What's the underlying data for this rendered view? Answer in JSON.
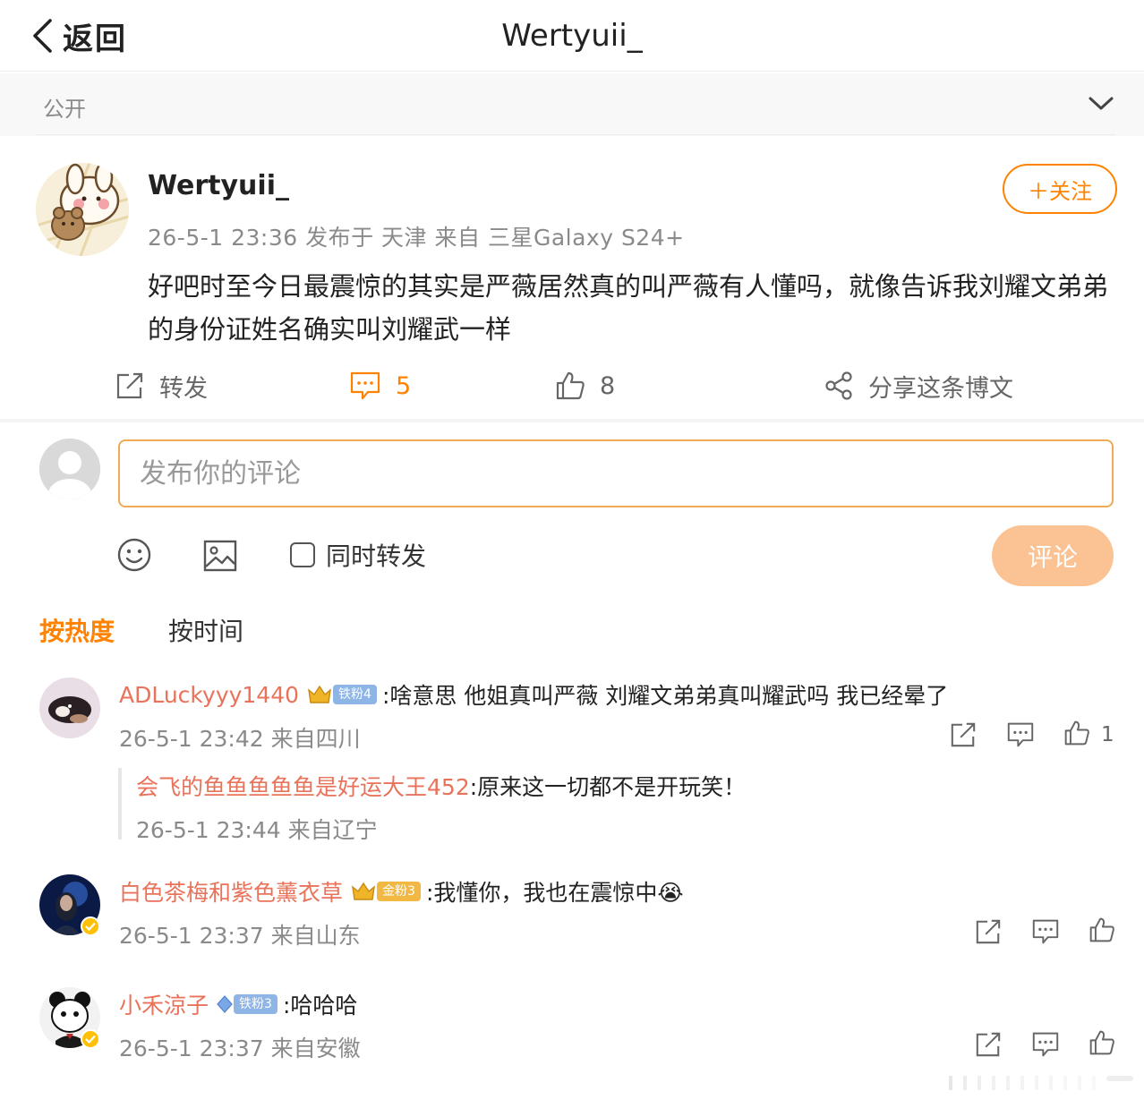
{
  "header": {
    "back_label": "返回",
    "title": "Wertyuii_"
  },
  "visibility": {
    "label": "公开"
  },
  "post": {
    "author": "Wertyuii_",
    "meta": "26-5-1 23:36  发布于 天津  来自 三星Galaxy S24+",
    "follow_label": "＋关注",
    "body": "好吧时至今日最震惊的其实是严薇居然真的叫严薇有人懂吗，就像告诉我刘耀文弟弟的身份证姓名确实叫刘耀武一样",
    "actions": {
      "repost": "转发",
      "comments": "5",
      "likes": "8",
      "share": "分享这条博文"
    }
  },
  "compose": {
    "placeholder": "发布你的评论",
    "also_repost_label": "同时转发",
    "submit_label": "评论"
  },
  "sort": {
    "hot": "按热度",
    "time": "按时间"
  },
  "comments": [
    {
      "name": "ADLuckyyy1440",
      "badge": "铁粉4",
      "text": ":啥意思 他姐真叫严薇 刘耀文弟弟真叫耀武吗 我已经晕了",
      "meta": "26-5-1 23:42 来自四川",
      "likes": "1",
      "reply": {
        "name": "会飞的鱼鱼鱼鱼鱼是好运大王452",
        "text": ":原来这一切都不是开玩笑！",
        "meta": "26-5-1 23:44 来自辽宁"
      }
    },
    {
      "name": "白色茶梅和紫色薰衣草",
      "badge": "金粉3",
      "text": ":我懂你，我也在震惊中😭",
      "meta": "26-5-1 23:37 来自山东",
      "likes": ""
    },
    {
      "name": "小禾涼子",
      "badge": "铁粉3",
      "text": ":哈哈哈",
      "meta": "26-5-1 23:37 来自安徽",
      "likes": ""
    }
  ],
  "colors": {
    "accent": "#ff8200",
    "username": "#e8735a",
    "submit_disabled": "#fbc394",
    "muted": "#8a8a8a"
  },
  "icons": {
    "back": "chevron-left-icon",
    "collapse": "chevron-down-icon",
    "repost": "repost-icon",
    "comment": "comment-icon",
    "like": "thumbs-up-icon",
    "share": "share-icon",
    "emoji": "emoji-icon",
    "image": "image-icon"
  }
}
